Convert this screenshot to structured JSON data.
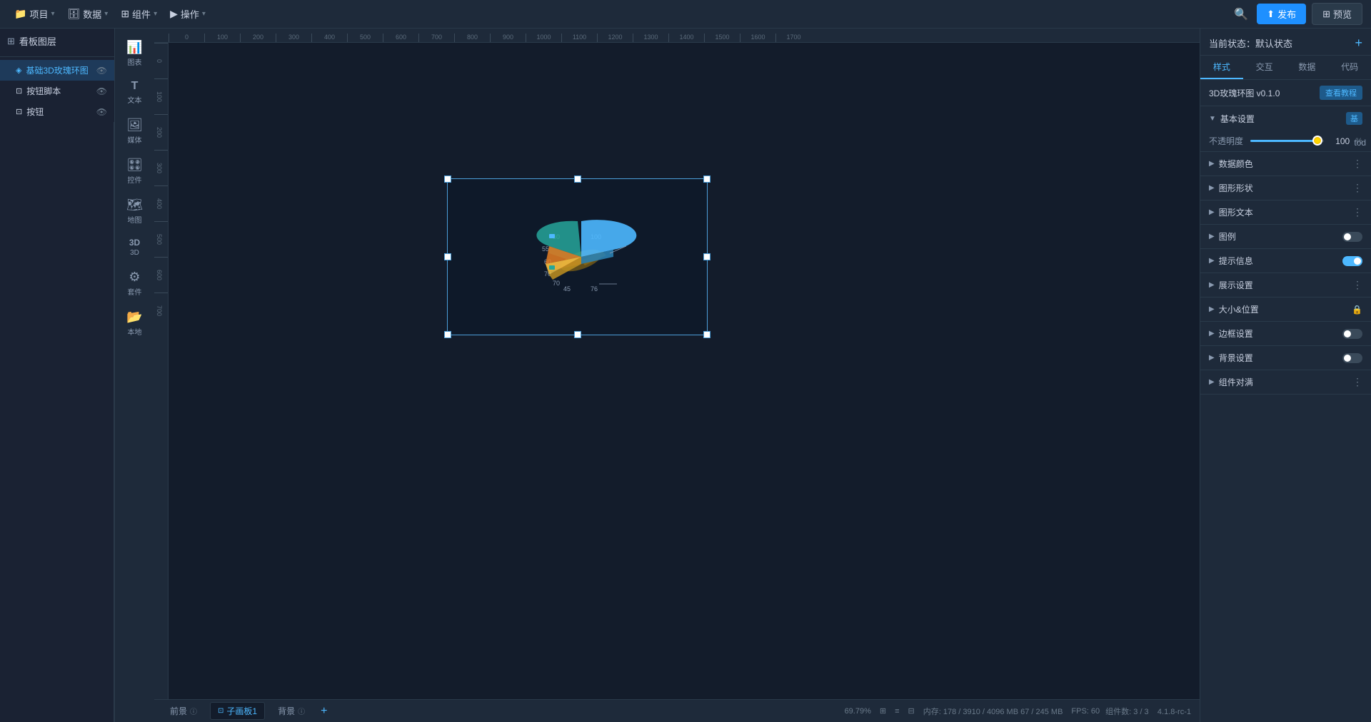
{
  "topbar": {
    "menu_items": [
      {
        "label": "项目",
        "icon": "📁"
      },
      {
        "label": "数据",
        "icon": "🗄"
      },
      {
        "label": "组件",
        "icon": "⊞"
      },
      {
        "label": "操作",
        "icon": "▶"
      }
    ],
    "publish_label": "发布",
    "preview_label": "预览"
  },
  "sidebar": {
    "header_label": "看板图层",
    "items": [
      {
        "label": "基础3D玫瑰环图",
        "active": true,
        "type": "chart"
      },
      {
        "label": "按钮脚本",
        "type": "script"
      },
      {
        "label": "按钮",
        "type": "button"
      }
    ]
  },
  "icon_panel": {
    "items": [
      {
        "icon": "📊",
        "label": "图表"
      },
      {
        "icon": "T",
        "label": "文本"
      },
      {
        "icon": "🖼",
        "label": "媒体"
      },
      {
        "icon": "🎛",
        "label": "控件"
      },
      {
        "icon": "🗺",
        "label": "地图"
      },
      {
        "icon": "3D",
        "label": "3D"
      },
      {
        "icon": "⚙",
        "label": "套件"
      },
      {
        "icon": "📂",
        "label": "本地"
      }
    ]
  },
  "ruler": {
    "top_marks": [
      "0",
      "100",
      "200",
      "300",
      "400",
      "500",
      "600",
      "700",
      "800",
      "900",
      "1000",
      "1100",
      "1200",
      "1300",
      "1400",
      "1500",
      "1600",
      "1700"
    ],
    "left_marks": [
      "0",
      "100",
      "200",
      "300",
      "400",
      "500",
      "600",
      "700"
    ]
  },
  "canvas": {
    "background": "#131c2b"
  },
  "right_panel": {
    "status_label": "当前状态：默认状态",
    "tabs": [
      "样式",
      "交互",
      "数据",
      "代码"
    ],
    "active_tab": "样式",
    "component_name": "3D玫瑰环图 v0.1.0",
    "tutorial_btn": "查看教程",
    "sections": [
      {
        "label": "基本设置",
        "expanded": true,
        "has_toggle": false,
        "has_blue_tag": true,
        "blue_tag": "基"
      },
      {
        "label": "数据颜色",
        "expanded": false,
        "has_toggle": false,
        "has_more": true
      },
      {
        "label": "图形形状",
        "expanded": false,
        "has_toggle": false,
        "has_more": true
      },
      {
        "label": "图形文本",
        "expanded": false,
        "has_toggle": false,
        "has_more": true
      },
      {
        "label": "图例",
        "expanded": false,
        "has_toggle": true,
        "toggle_on": false,
        "has_more": false
      },
      {
        "label": "提示信息",
        "expanded": false,
        "has_toggle": true,
        "toggle_on": true,
        "has_more": false
      },
      {
        "label": "展示设置",
        "expanded": false,
        "has_toggle": false,
        "has_more": true
      },
      {
        "label": "大小&位置",
        "expanded": false,
        "has_toggle": false,
        "has_lock": true
      },
      {
        "label": "边框设置",
        "expanded": false,
        "has_toggle": true,
        "toggle_on": false,
        "has_more": false
      },
      {
        "label": "背景设置",
        "expanded": false,
        "has_toggle": true,
        "toggle_on": false,
        "has_more": false
      },
      {
        "label": "组件对满",
        "expanded": false,
        "has_toggle": false,
        "has_more": true
      }
    ],
    "opacity": {
      "label": "不透明度",
      "value": "100",
      "unit": "%"
    }
  },
  "bottom_bar": {
    "pages": [
      {
        "label": "前景",
        "active": false
      },
      {
        "label": "子画板1",
        "active": true
      },
      {
        "label": "背景",
        "active": false
      }
    ],
    "add_label": "+",
    "zoom": "69.79%",
    "memory": "内存: 178 / 3910 / 4096 MB  67 / 245 MB",
    "fps": "FPS: 60",
    "components": "组件数: 3 / 3",
    "version": "4.1.8-rc-1",
    "tod": "tod"
  }
}
